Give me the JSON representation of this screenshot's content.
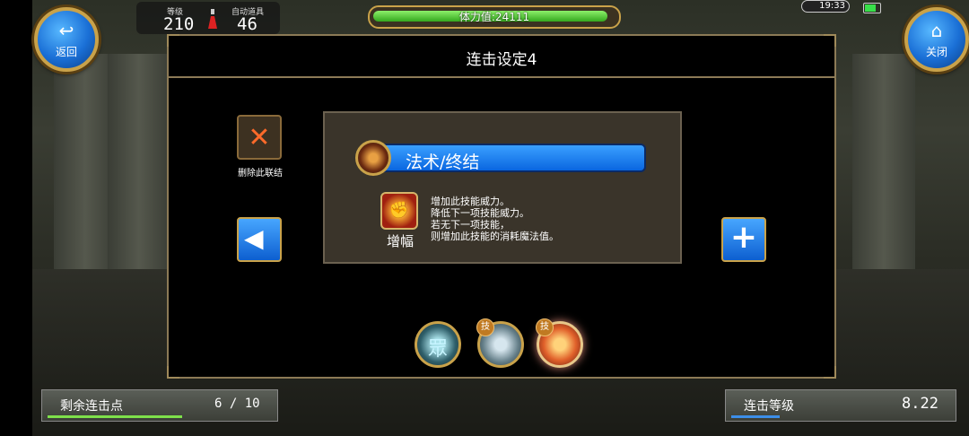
{
  "hud": {
    "back_label": "返回",
    "close_label": "关闭",
    "level_caption": "等级",
    "level_value": "210",
    "auto_item_caption": "自动道具",
    "auto_item_value": "46",
    "stamina_text": "体力值:24111",
    "stamina_fraction": 0.98,
    "clock": "19:33"
  },
  "dialog": {
    "title": "连击设定4",
    "delete_icon": "✕",
    "delete_label": "删除此联结",
    "skill_name": "法术/终结",
    "buff_icon_glyph": "✊",
    "buff_label": "增幅",
    "description_lines": [
      "增加此技能威力。",
      "降低下一项技能威力。",
      "若无下一项技能，",
      "则增加此技能的消耗魔法值。"
    ],
    "prev_icon": "◀",
    "add_icon": "+",
    "combo_badge": "技",
    "combo_glyph": "眾"
  },
  "bottom": {
    "remaining_label": "剩余连击点",
    "remaining_value": "6 / 10",
    "remaining_fraction": 0.6,
    "combo_level_label": "连击等级",
    "combo_level_value": "8.22",
    "combo_level_fraction": 0.22
  },
  "colors": {
    "accent_blue": "#0a66e0",
    "gold_border": "#c9a24a",
    "stamina_green": "#34a81e"
  }
}
